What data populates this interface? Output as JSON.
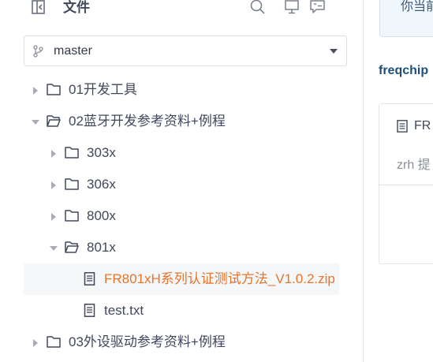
{
  "header": {
    "title": "文件",
    "icons": [
      "collapse-sidebar-icon",
      "search-icon",
      "monitor-icon",
      "comment-icon"
    ]
  },
  "branch": {
    "label": "master",
    "icon": "branch-icon"
  },
  "tree": [
    {
      "label": "01开发工具",
      "type": "folder",
      "expanded": false
    },
    {
      "label": "02蓝牙开发参考资料+例程",
      "type": "folder",
      "expanded": true
    },
    {
      "label": "303x",
      "type": "folder",
      "expanded": false
    },
    {
      "label": "306x",
      "type": "folder",
      "expanded": false
    },
    {
      "label": "800x",
      "type": "folder",
      "expanded": false
    },
    {
      "label": "801x",
      "type": "folder",
      "expanded": true
    },
    {
      "label": "FR801xH系列认证测试方法_V1.0.2.zip",
      "type": "file",
      "selected": true
    },
    {
      "label": "test.txt",
      "type": "file",
      "selected": false
    },
    {
      "label": "03外设驱动参考资料+例程",
      "type": "folder",
      "expanded": false
    }
  ],
  "right": {
    "notice": "你当前",
    "repo_name": "freqchip",
    "card_title": "FR",
    "card_author": "zrh 提"
  },
  "colors": {
    "selected_text": "#e8742a",
    "text": "#40485b",
    "repo_link": "#1f4f79"
  }
}
